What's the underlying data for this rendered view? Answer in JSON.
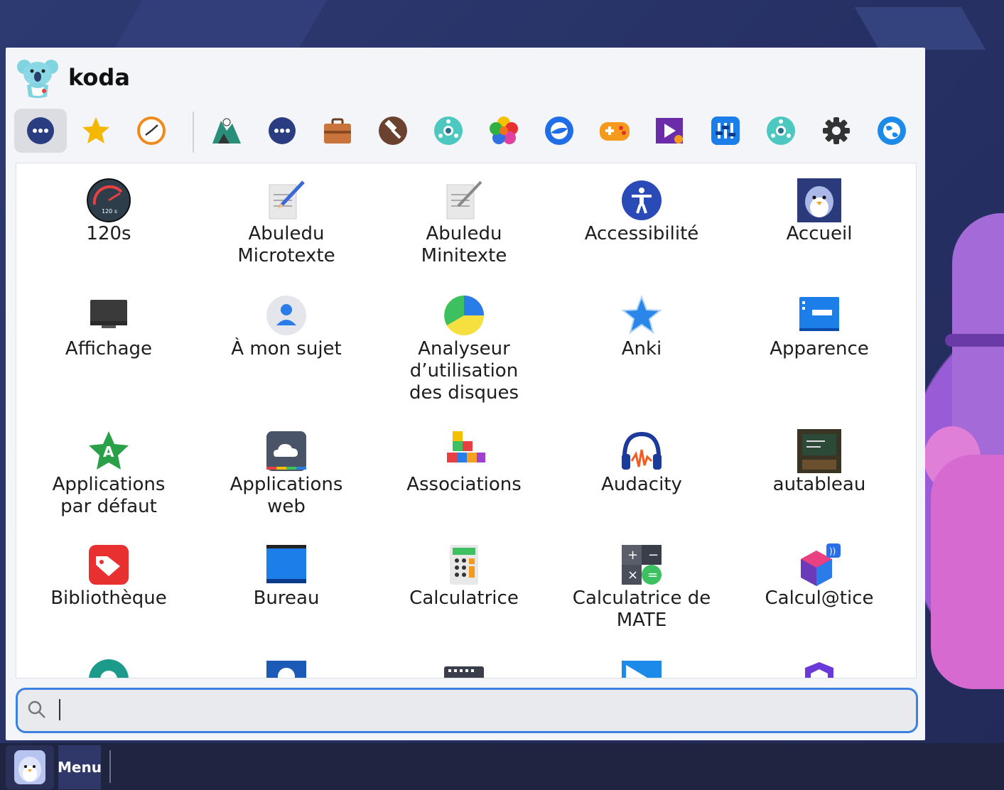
{
  "user": {
    "name": "koda"
  },
  "categories": [
    {
      "name": "all",
      "icon": "dots-icon",
      "active": true
    },
    {
      "name": "favorites",
      "icon": "star-icon"
    },
    {
      "name": "recent",
      "icon": "clock-icon"
    },
    {
      "name": "education",
      "icon": "education-icon"
    },
    {
      "name": "other",
      "icon": "dots-icon"
    },
    {
      "name": "office",
      "icon": "briefcase-icon"
    },
    {
      "name": "development",
      "icon": "hammer-icon"
    },
    {
      "name": "science",
      "icon": "science-icon"
    },
    {
      "name": "graphics",
      "icon": "graphics-icon"
    },
    {
      "name": "internet",
      "icon": "internet-icon"
    },
    {
      "name": "games",
      "icon": "gamepad-icon"
    },
    {
      "name": "multimedia",
      "icon": "multimedia-icon"
    },
    {
      "name": "system",
      "icon": "system-icon"
    },
    {
      "name": "science2",
      "icon": "science-icon"
    },
    {
      "name": "settings",
      "icon": "gear-icon"
    },
    {
      "name": "web",
      "icon": "globe-icon"
    }
  ],
  "apps": [
    {
      "label": "120s",
      "icon": "timer-icon"
    },
    {
      "label": "Abuledu Microtexte",
      "icon": "notepad-pencil-icon"
    },
    {
      "label": "Abuledu Minitexte",
      "icon": "notepad-icon"
    },
    {
      "label": "Accessibilité",
      "icon": "accessibility-icon"
    },
    {
      "label": "Accueil",
      "icon": "penguin-icon"
    },
    {
      "label": "Affichage",
      "icon": "monitor-icon"
    },
    {
      "label": "À mon sujet",
      "icon": "user-icon"
    },
    {
      "label": "Analyseur d’utilisation des disques",
      "icon": "pie-chart-icon"
    },
    {
      "label": "Anki",
      "icon": "star-icon"
    },
    {
      "label": "Apparence",
      "icon": "window-icon"
    },
    {
      "label": "Applications par défaut",
      "icon": "default-apps-icon"
    },
    {
      "label": "Applications web",
      "icon": "cloud-icon"
    },
    {
      "label": "Associations",
      "icon": "blocks-icon"
    },
    {
      "label": "Audacity",
      "icon": "headphones-icon"
    },
    {
      "label": "autableau",
      "icon": "blackboard-icon"
    },
    {
      "label": "Bibliothèque",
      "icon": "tag-icon"
    },
    {
      "label": "Bureau",
      "icon": "desktop-icon"
    },
    {
      "label": "Calculatrice",
      "icon": "calculator-icon"
    },
    {
      "label": "Calculatrice de MATE",
      "icon": "mate-calculator-icon"
    },
    {
      "label": "Calcul@tice",
      "icon": "calculatice-icon"
    }
  ],
  "search": {
    "value": "",
    "placeholder": ""
  },
  "taskbar": {
    "menu_label": "Menu"
  }
}
